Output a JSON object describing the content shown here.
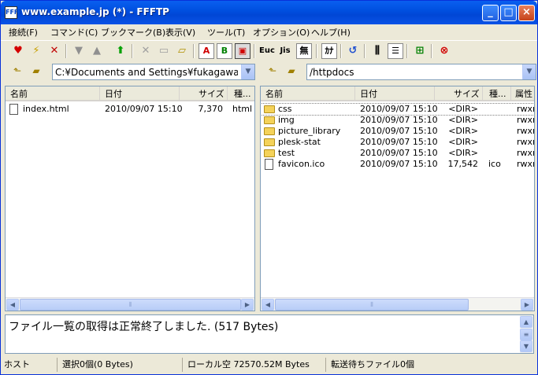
{
  "window": {
    "title": "www.example.jp (*) - FFFTP",
    "app_icon": "FFFTP"
  },
  "menu": [
    {
      "label": "接続(F)"
    },
    {
      "label": "コマンド(C)"
    },
    {
      "label": "ブックマーク(B)"
    },
    {
      "label": "表示(V)"
    },
    {
      "label": "ツール(T)"
    },
    {
      "label": "オプション(O)"
    },
    {
      "label": "ヘルプ(H)"
    }
  ],
  "toolbar": {
    "icons": [
      "connect-icon",
      "quick-connect-icon",
      "disconnect-icon",
      "download-icon",
      "upload-icon",
      "mirror-upload-icon",
      "delete-icon",
      "rename-icon",
      "new-folder-icon",
      "ascii-mode-icon",
      "binary-mode-icon",
      "auto-mode-icon",
      "host-euc-icon",
      "host-jis-icon",
      "no-convert-icon",
      "kana-convert-icon",
      "refresh-icon",
      "list-view-icon",
      "detail-view-icon",
      "sync-folder-icon",
      "stop-icon"
    ],
    "labels": {
      "ascii": "A",
      "binary": "B",
      "euc": "Euc",
      "jis": "Jis",
      "no_convert": "無",
      "kana": "ｶﾅ"
    }
  },
  "local": {
    "path": "C:¥Documents and Settings¥fukagawa¥My Documents",
    "columns": [
      "名前",
      "日付",
      "サイズ",
      "種..."
    ],
    "files": [
      {
        "name": "index.html",
        "date": "2010/09/07 15:10",
        "size": "7,370",
        "type": "html",
        "icon": "file-icon"
      }
    ]
  },
  "remote": {
    "path": "/httpdocs",
    "columns": [
      "名前",
      "日付",
      "サイズ",
      "種...",
      "属性"
    ],
    "files": [
      {
        "name": "css",
        "date": "2010/09/07 15:10",
        "size": "<DIR>",
        "type": "",
        "attr": "rwxr",
        "icon": "folder-icon"
      },
      {
        "name": "img",
        "date": "2010/09/07 15:10",
        "size": "<DIR>",
        "type": "",
        "attr": "rwxr",
        "icon": "folder-icon"
      },
      {
        "name": "picture_library",
        "date": "2010/09/07 15:10",
        "size": "<DIR>",
        "type": "",
        "attr": "rwxr",
        "icon": "folder-icon"
      },
      {
        "name": "plesk-stat",
        "date": "2010/09/07 15:10",
        "size": "<DIR>",
        "type": "",
        "attr": "rwxr",
        "icon": "folder-icon"
      },
      {
        "name": "test",
        "date": "2010/09/07 15:10",
        "size": "<DIR>",
        "type": "",
        "attr": "rwxr",
        "icon": "folder-icon"
      },
      {
        "name": "favicon.ico",
        "date": "2010/09/07 15:10",
        "size": "17,542",
        "type": "ico",
        "attr": "rwxr",
        "icon": "file-icon"
      }
    ]
  },
  "log": {
    "message": "ファイル一覧の取得は正常終了しました. (517 Bytes)"
  },
  "status": {
    "host": "ホスト",
    "selection": "選択0個(0 Bytes)",
    "local_free": "ローカル空 72570.52M Bytes",
    "queue": "転送待ちファイル0個"
  },
  "colors": {
    "titlebar": "#0054e3",
    "window_bg": "#ece9d8",
    "selection_border": "#808080"
  }
}
